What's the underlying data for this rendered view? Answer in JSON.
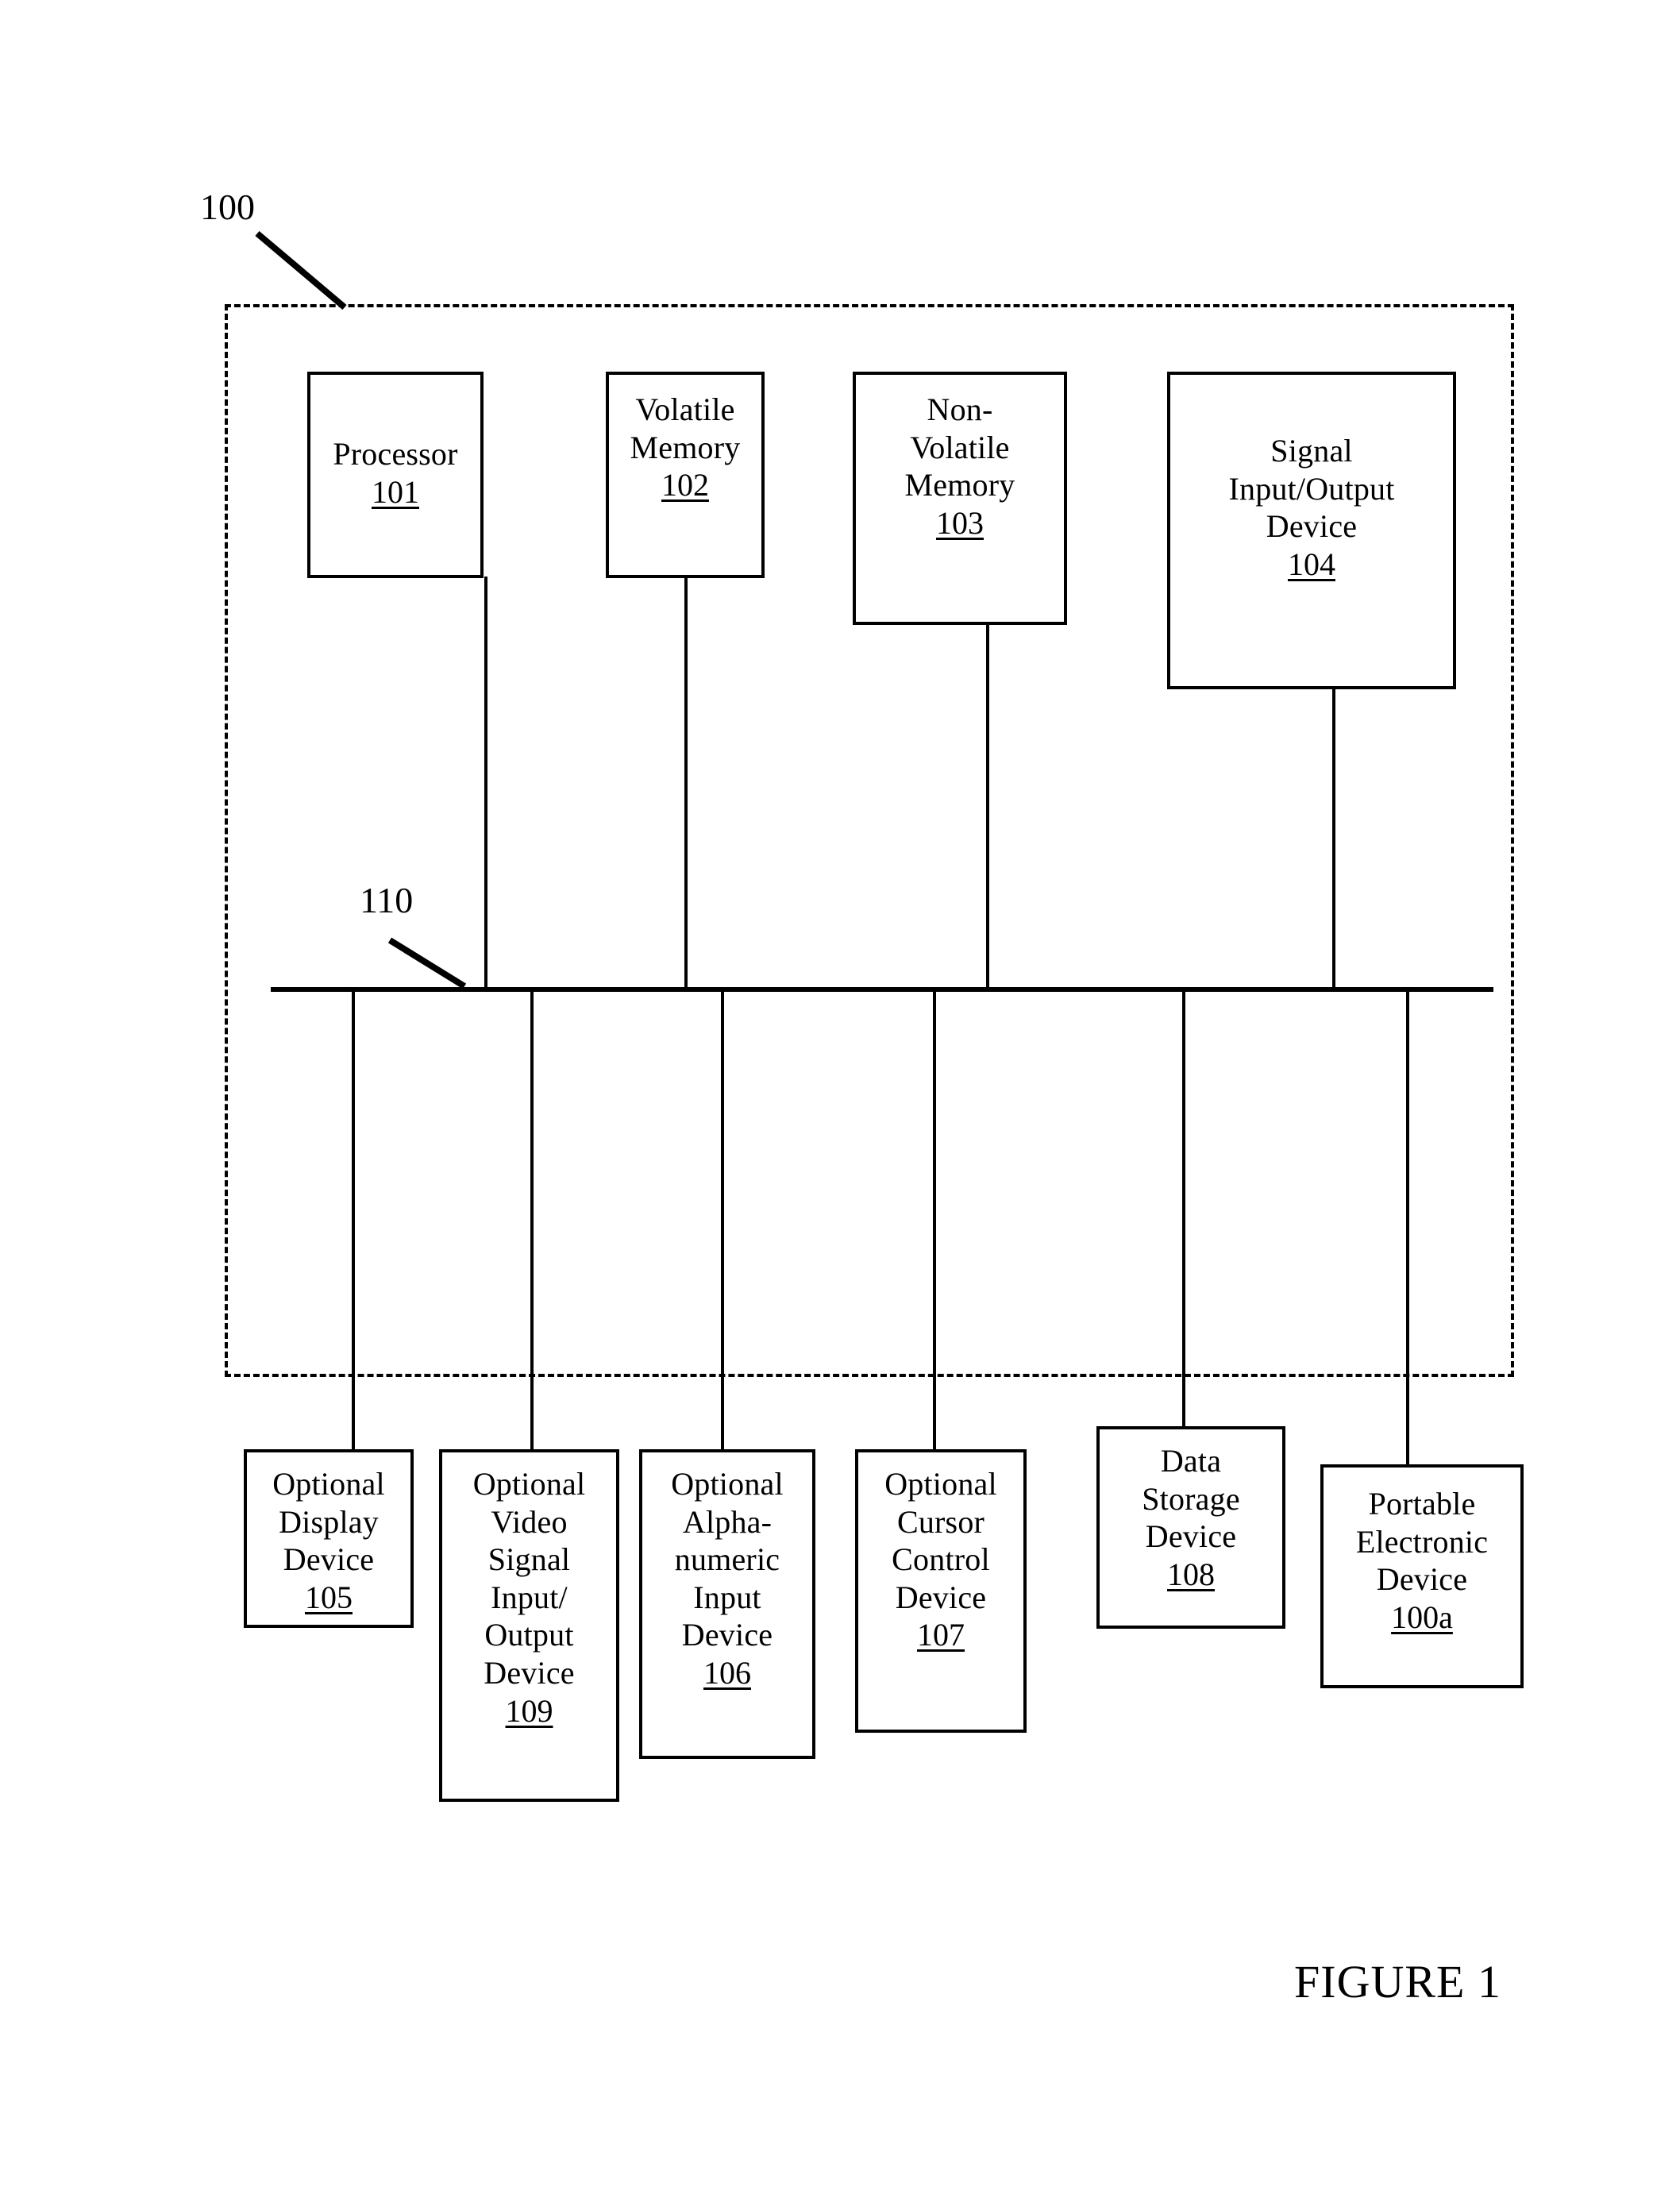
{
  "figure": {
    "caption": "FIGURE 1",
    "system_ref": "100",
    "bus_ref": "110"
  },
  "nodes": {
    "processor": {
      "label": "Processor",
      "ref": "101"
    },
    "volatile_memory": {
      "label": "Volatile\nMemory",
      "ref": "102"
    },
    "nonvolatile_memory": {
      "label": "Non-\nVolatile\nMemory",
      "ref": "103"
    },
    "signal_io_device": {
      "label": "Signal\nInput/Output\nDevice",
      "ref": "104"
    },
    "display_device": {
      "label": "Optional\nDisplay\nDevice",
      "ref": "105"
    },
    "video_signal_io": {
      "label": "Optional\nVideo\nSignal\nInput/\nOutput\nDevice",
      "ref": "109"
    },
    "alphanumeric_input": {
      "label": "Optional\nAlpha-\nnumeric\nInput\nDevice",
      "ref": "106"
    },
    "cursor_control": {
      "label": "Optional\nCursor\nControl\nDevice",
      "ref": "107"
    },
    "data_storage": {
      "label": "Data\nStorage\nDevice",
      "ref": "108"
    },
    "portable_device": {
      "label": "Portable\nElectronic\nDevice",
      "ref": "100a"
    }
  }
}
